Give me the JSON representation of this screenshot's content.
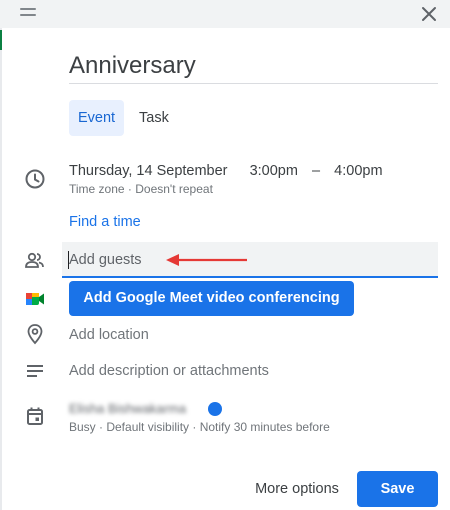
{
  "dialog": {
    "title": "Anniversary",
    "tabs": [
      {
        "label": "Event",
        "selected": true
      },
      {
        "label": "Task",
        "selected": false
      }
    ]
  },
  "datetime": {
    "date": "Thursday, 14 September",
    "start": "3:00pm",
    "separator": "–",
    "end": "4:00pm",
    "details": "Time zone · Doesn't repeat",
    "find_time": "Find a time"
  },
  "guests": {
    "placeholder": "Add guests"
  },
  "meet": {
    "button_label": "Add Google Meet video conferencing"
  },
  "location": {
    "placeholder": "Add location"
  },
  "description": {
    "placeholder": "Add description or attachments"
  },
  "calendar": {
    "owner_name": "Elisha Bishwakarma",
    "details": "Busy · Default visibility · Notify 30 minutes before",
    "color": "#1a73e8"
  },
  "footer": {
    "more_options": "More options",
    "save": "Save"
  },
  "colors": {
    "accent": "#1a73e8",
    "annotation_arrow": "#e53935"
  },
  "icons": [
    "drag-handle-icon",
    "close-icon",
    "clock-icon",
    "people-icon",
    "google-meet-icon",
    "location-pin-icon",
    "notes-icon",
    "calendar-icon"
  ]
}
